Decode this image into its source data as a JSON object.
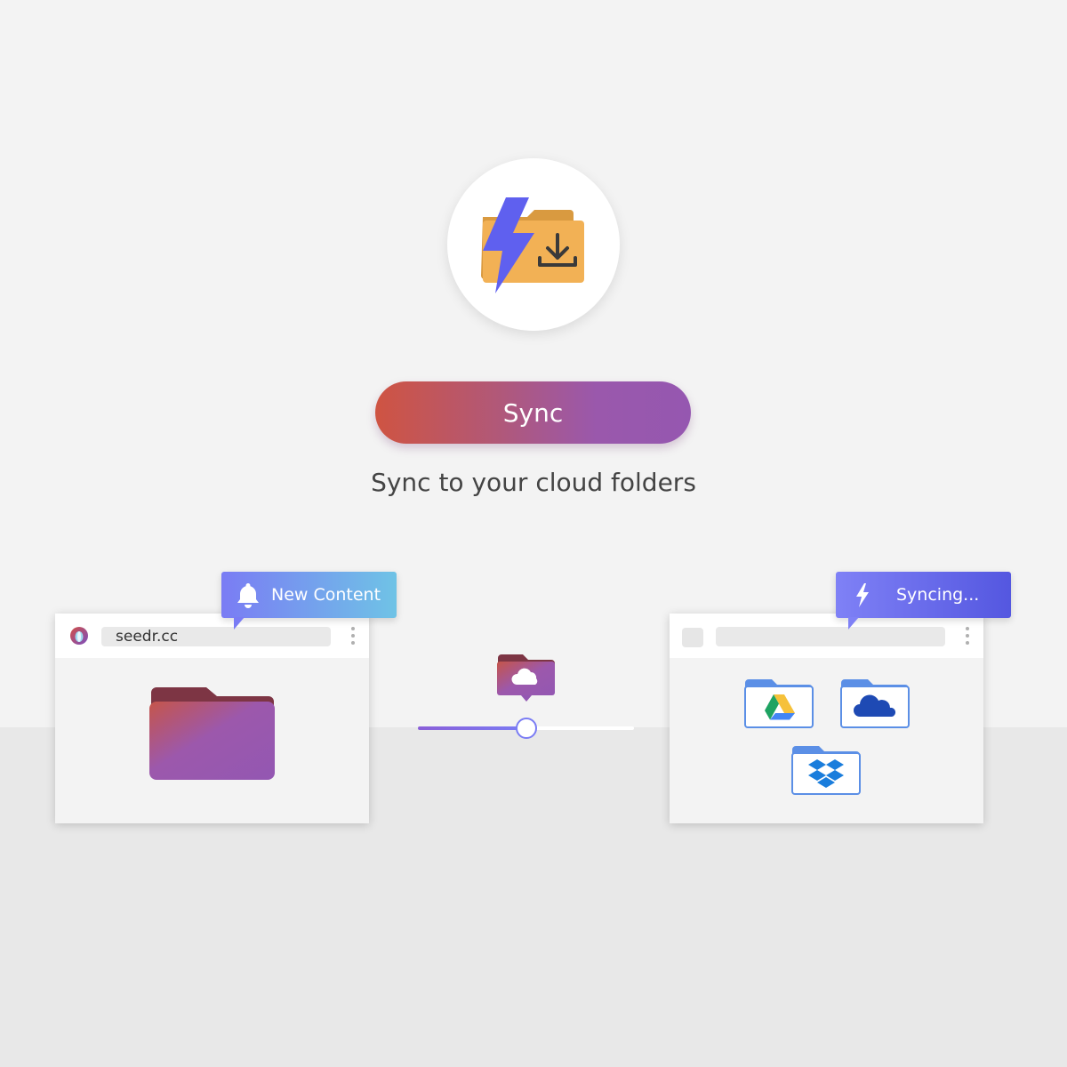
{
  "hero": {
    "icon": "lightning-download-folder-icon"
  },
  "sync_button": {
    "label": "Sync"
  },
  "tagline": "Sync to your cloud folders",
  "left_browser": {
    "favicon": "seedr-logo-icon",
    "url": "seedr.cc",
    "notification": {
      "icon": "bell-icon",
      "label": "New Content"
    },
    "content_icon": "folder-icon"
  },
  "transfer": {
    "icon": "cloud-folder-icon",
    "progress": 0.5
  },
  "right_browser": {
    "url": "",
    "notification": {
      "icon": "lightning-icon",
      "label": "Syncing..."
    },
    "services": [
      {
        "name": "google-drive",
        "icon": "google-drive-icon"
      },
      {
        "name": "onedrive",
        "icon": "onedrive-icon"
      },
      {
        "name": "dropbox",
        "icon": "dropbox-icon"
      }
    ]
  },
  "colors": {
    "background": "#f3f3f3",
    "floor": "#e8e8e8",
    "accent_red": "#cf5442",
    "accent_purple": "#9557b0",
    "accent_blue": "#7a7cf4",
    "folder_orange": "#f2b155"
  }
}
